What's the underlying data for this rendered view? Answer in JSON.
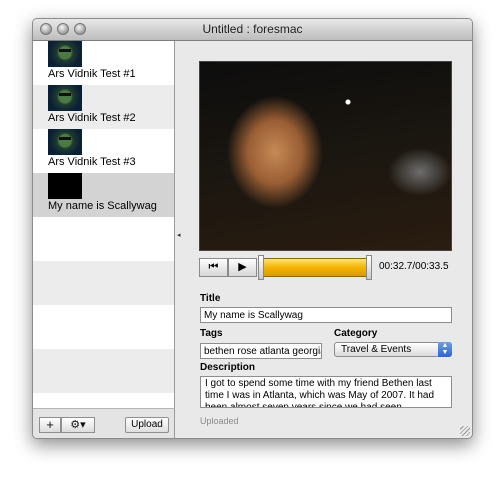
{
  "window": {
    "title": "Untitled : foresmac"
  },
  "sidebar": {
    "items": [
      {
        "label": "Ars Vidnik Test #1"
      },
      {
        "label": "Ars Vidnik Test #2"
      },
      {
        "label": "Ars Vidnik Test #3"
      },
      {
        "label": "My name is Scallywag"
      }
    ],
    "selected_index": 3,
    "add_button": "+",
    "gear_button": "⚙▾",
    "upload_button": "Upload"
  },
  "player": {
    "rewind_icon": "rewind-icon",
    "play_icon": "play-icon",
    "time": "00:32.7/00:33.5",
    "progress_fraction": 0.976
  },
  "form": {
    "title_label": "Title",
    "title_value": "My name is Scallywag",
    "tags_label": "Tags",
    "tags_value": "bethen rose atlanta georgia",
    "category_label": "Category",
    "category_value": "Travel & Events",
    "description_label": "Description",
    "description_value": "I got to spend some time with my friend Bethen last time I was in Atlanta, which was May of 2007. It had been almost seven years since we had seen",
    "status": "Uploaded"
  },
  "colors": {
    "selection": "#d3d3d3",
    "scrubber": "#f3b400",
    "popup_accent": "#2f64c8"
  }
}
